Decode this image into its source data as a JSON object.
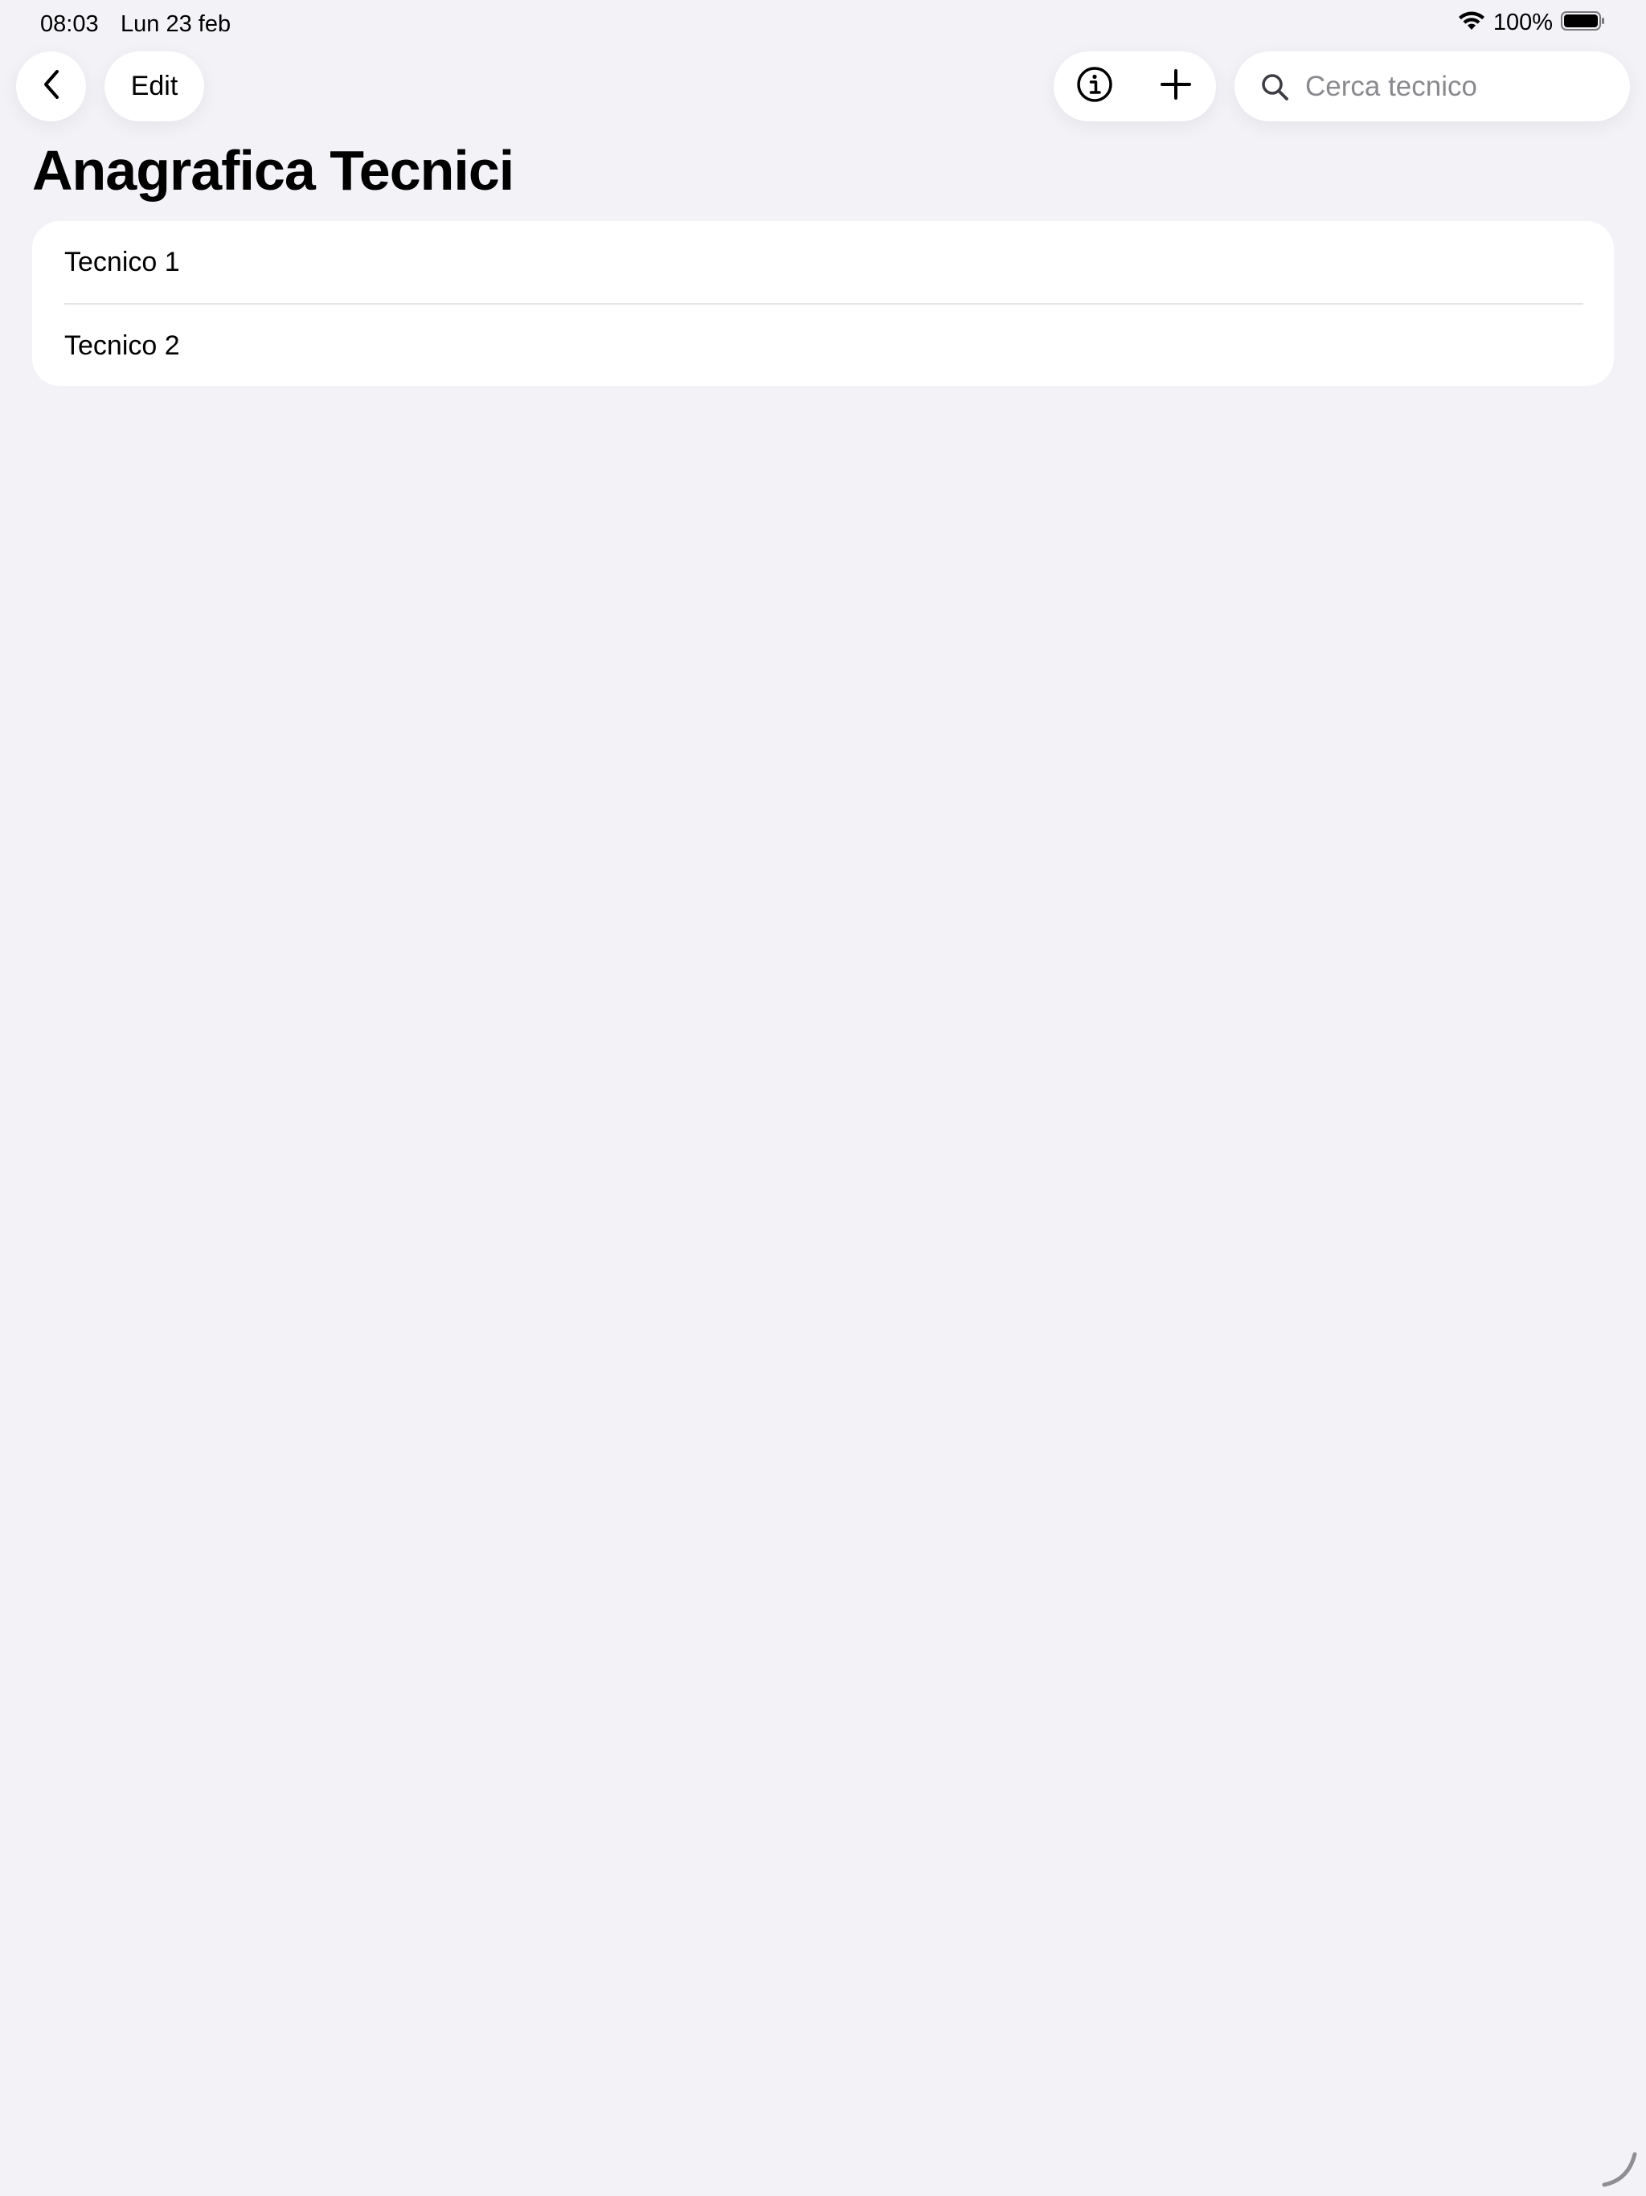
{
  "status_bar": {
    "time": "08:03",
    "date": "Lun 23 feb",
    "battery": "100%"
  },
  "nav": {
    "edit_label": "Edit"
  },
  "search": {
    "placeholder": "Cerca tecnico",
    "value": ""
  },
  "page": {
    "title": "Anagrafica Tecnici"
  },
  "list": {
    "items": [
      {
        "label": "Tecnico 1"
      },
      {
        "label": "Tecnico 2"
      }
    ]
  },
  "colors": {
    "background": "#f2f2f7",
    "surface": "#ffffff",
    "placeholder": "#8a8a8e",
    "separator": "#e3e3e8"
  },
  "icons": [
    "chevron-left-icon",
    "info-icon",
    "plus-icon",
    "search-icon",
    "wifi-icon",
    "battery-icon"
  ]
}
